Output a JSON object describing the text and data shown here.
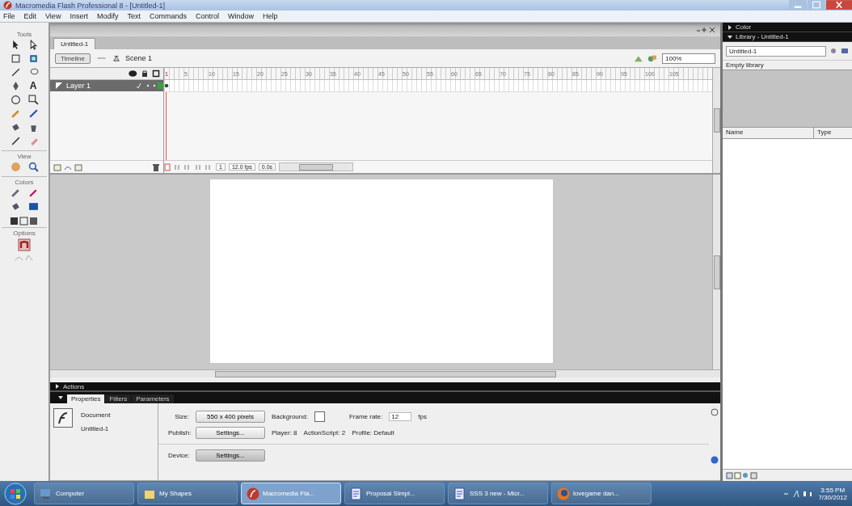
{
  "window": {
    "title": "Macromedia Flash Professional 8 - [Untitled-1]"
  },
  "menu": [
    "File",
    "Edit",
    "View",
    "Insert",
    "Modify",
    "Text",
    "Commands",
    "Control",
    "Window",
    "Help"
  ],
  "tools_panel": {
    "title": "Tools",
    "text_tool_glyph": "A",
    "view_label": "View",
    "colors_label": "Colors",
    "options_label": "Options"
  },
  "document_tab": {
    "label": "Untitled-1",
    "selected": true
  },
  "edit_bar": {
    "timeline_button": "Timeline",
    "scene": "Scene 1",
    "zoom": "100%"
  },
  "timeline": {
    "frame_numbers": [
      "1",
      "5",
      "10",
      "15",
      "20",
      "25",
      "30",
      "35",
      "40",
      "45",
      "50",
      "55",
      "60",
      "65",
      "70",
      "75",
      "80",
      "85",
      "90",
      "95",
      "100",
      "105"
    ],
    "layers": [
      {
        "name": "Layer 1",
        "selected": true
      }
    ],
    "current_frame": "1",
    "frame_rate": "12.0 fps",
    "elapsed": "0.0s"
  },
  "panels": {
    "actions": "Actions",
    "tabs": [
      {
        "label": "Properties",
        "selected": true
      },
      {
        "label": "Filters",
        "selected": false
      },
      {
        "label": "Parameters",
        "selected": false
      }
    ]
  },
  "properties": {
    "type": "Document",
    "name": "Untitled-1",
    "size_label": "Size:",
    "size_button": "550 x 400 pixels",
    "background_label": "Background:",
    "frame_rate_label": "Frame rate:",
    "frame_rate": "12",
    "fps": "fps",
    "publish_label": "Publish:",
    "publish_button": "Settings...",
    "player": "Player: 8",
    "actionscript": "ActionScript: 2",
    "profile": "Profile: Default",
    "device_label": "Device:",
    "device_button": "Settings..."
  },
  "right_panel": {
    "color_title": "Color",
    "library_title": "Library - Untitled-1",
    "library_select": "Untitled-1",
    "empty_message": "Empty library",
    "columns": [
      "Name",
      "Type"
    ]
  },
  "taskbar": {
    "items": [
      {
        "label": "Computer",
        "kind": "computer",
        "selected": false
      },
      {
        "label": "My Shapes",
        "kind": "folder",
        "selected": false
      },
      {
        "label": "Macromedia Fla...",
        "kind": "flash",
        "selected": true
      },
      {
        "label": "Proposal Simpl...",
        "kind": "document",
        "selected": false
      },
      {
        "label": "SSS 3 new - Micr...",
        "kind": "document",
        "selected": false
      },
      {
        "label": "lovegame dan...",
        "kind": "browser",
        "selected": false
      }
    ],
    "time": "3:55 PM",
    "date": "7/30/2012"
  }
}
